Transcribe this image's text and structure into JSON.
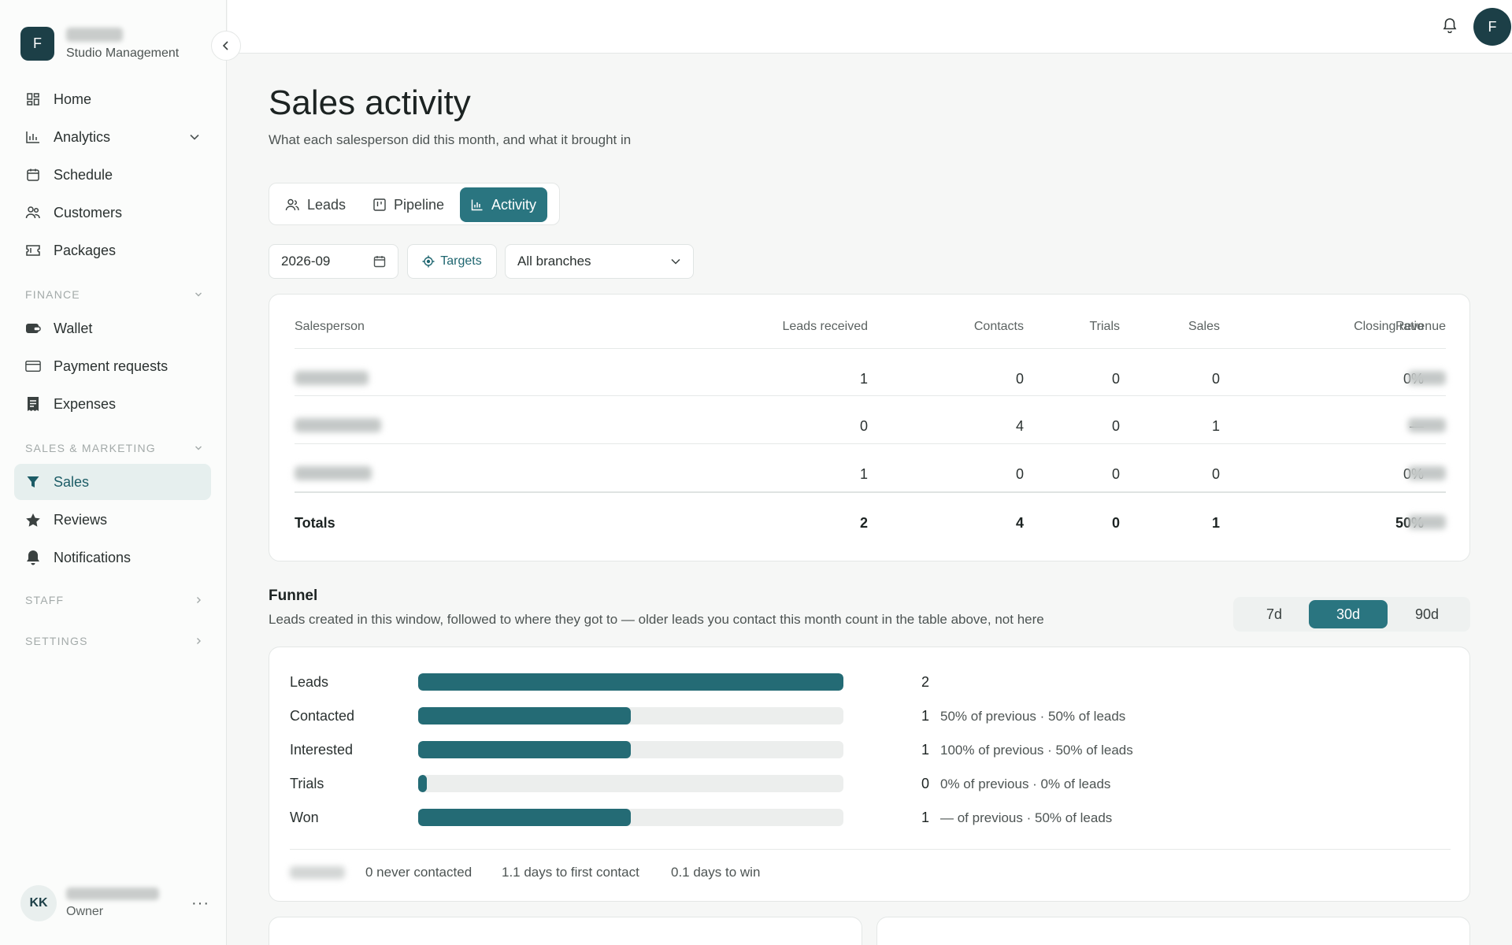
{
  "brand": {
    "logo_letter": "F",
    "subtitle": "Studio Management"
  },
  "nav": {
    "home": "Home",
    "analytics": "Analytics",
    "schedule": "Schedule",
    "customers": "Customers",
    "packages": "Packages",
    "finance_label": "FINANCE",
    "wallet": "Wallet",
    "payment_requests": "Payment requests",
    "expenses": "Expenses",
    "sales_marketing_label": "SALES & MARKETING",
    "sales": "Sales",
    "reviews": "Reviews",
    "notifications": "Notifications",
    "staff_label": "STAFF",
    "settings_label": "SETTINGS"
  },
  "user": {
    "initials": "KK",
    "role": "Owner",
    "more": "···"
  },
  "topbar": {
    "avatar_letter": "F"
  },
  "page": {
    "title": "Sales activity",
    "subtitle": "What each salesperson did this month, and what it brought in"
  },
  "tabs": {
    "leads": "Leads",
    "pipeline": "Pipeline",
    "activity": "Activity",
    "active": "activity"
  },
  "filters": {
    "date": "2026-09",
    "targets": "Targets",
    "branch": "All branches"
  },
  "table": {
    "headers": {
      "salesperson": "Salesperson",
      "leads_received": "Leads received",
      "contacts": "Contacts",
      "trials": "Trials",
      "sales": "Sales",
      "closing_ratio": "Closing ratio",
      "revenue": "Revenue"
    },
    "rows": [
      {
        "leads_received": "1",
        "contacts": "0",
        "trials": "0",
        "sales": "0",
        "closing_ratio": "0%"
      },
      {
        "leads_received": "0",
        "contacts": "4",
        "trials": "0",
        "sales": "1",
        "closing_ratio": "—"
      },
      {
        "leads_received": "1",
        "contacts": "0",
        "trials": "0",
        "sales": "0",
        "closing_ratio": "0%"
      }
    ],
    "totals": {
      "label": "Totals",
      "leads_received": "2",
      "contacts": "4",
      "trials": "0",
      "sales": "1",
      "closing_ratio": "50%"
    }
  },
  "funnel": {
    "title": "Funnel",
    "subtitle": "Leads created in this window, followed to where they got to — older leads you contact this month count in the table above, not here",
    "ranges": {
      "d7": "7d",
      "d30": "30d",
      "d90": "90d",
      "active": "30d"
    },
    "stages": [
      {
        "label": "Leads",
        "count": "2",
        "fill": 1.0,
        "note": ""
      },
      {
        "label": "Contacted",
        "count": "1",
        "fill": 0.5,
        "note": "50% of previous · 50% of leads"
      },
      {
        "label": "Interested",
        "count": "1",
        "fill": 0.5,
        "note": "100% of previous · 50% of leads"
      },
      {
        "label": "Trials",
        "count": "0",
        "fill": 0.0,
        "note": "0% of previous · 0% of leads"
      },
      {
        "label": "Won",
        "count": "1",
        "fill": 0.5,
        "note": "— of previous · 50% of leads"
      }
    ],
    "footer": {
      "never_contacted": "0 never contacted",
      "first_contact": "1.1 days to first contact",
      "days_to_win": "0.1 days to win"
    }
  },
  "colors": {
    "accent": "#2a7580",
    "brand": "#1c3f47",
    "bar": "#246b75"
  }
}
